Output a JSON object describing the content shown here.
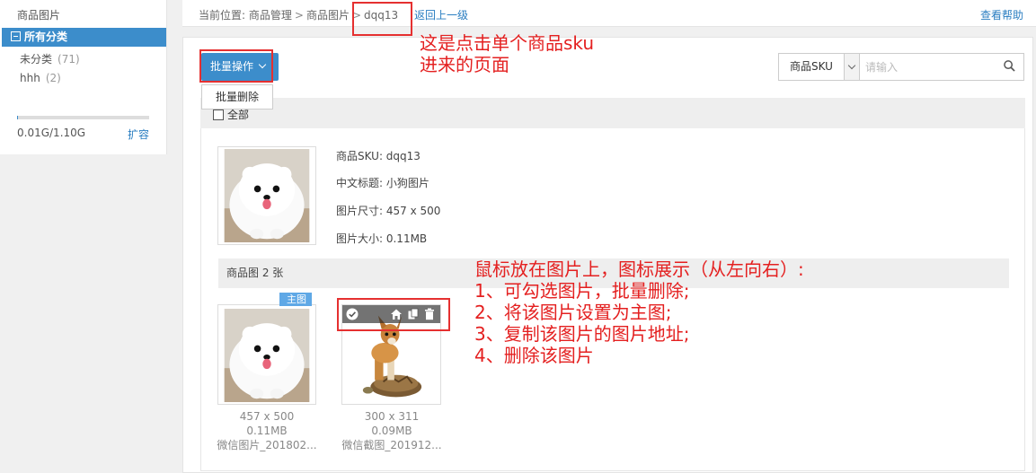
{
  "sidebar": {
    "title": "商品图片",
    "all_category": "所有分类",
    "categories": [
      {
        "name": "未分类",
        "count": "(71)"
      },
      {
        "name": "hhh",
        "count": "(2)"
      }
    ],
    "storage_text": "0.01G/1.10G",
    "storage_fraction": 0.01,
    "expand_label": "扩容"
  },
  "topbar": {
    "breadcrumb_prefix": "当前位置:",
    "crumbs": [
      "商品管理",
      "商品图片",
      "dqq13"
    ],
    "back_label": "返回上一级",
    "help_label": "查看帮助"
  },
  "toolbar": {
    "batch_label": "批量操作",
    "batch_delete_label": "批量删除",
    "search_field_label": "商品SKU",
    "search_placeholder": "请输入",
    "select_all_label": "全部"
  },
  "product": {
    "sku_line": "商品SKU:  dqq13",
    "title_line": "中文标题:  小狗图片",
    "size_line": "图片尺寸:  457 x 500",
    "filesize_line": "图片大小:  0.11MB"
  },
  "gallery": {
    "header": "商品图 2 张",
    "main_tag": "主图",
    "images": [
      {
        "dims": "457 x 500",
        "size": "0.11MB",
        "name": "微信图片_201802..."
      },
      {
        "dims": "300 x 311",
        "size": "0.09MB",
        "name": "微信截图_201912..."
      }
    ]
  },
  "annotations": {
    "top_note": [
      "这是点击单个商品sku",
      "进来的页面"
    ],
    "hover_note": [
      "鼠标放在图片上，图标展示（从左向右）:",
      "1、可勾选图片，批量删除;",
      "2、将该图片设置为主图;",
      "3、复制该图片的图片地址;",
      "4、删除该图片"
    ]
  },
  "colors": {
    "accent": "#3c8dcb",
    "link": "#2a7ec1",
    "annotation": "#e42020"
  }
}
